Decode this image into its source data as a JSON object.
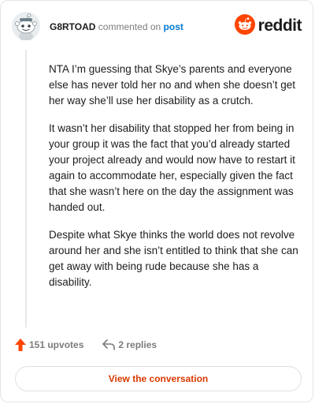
{
  "header": {
    "username": "G8RTOAD",
    "commented_text": "commented on",
    "post_link": "post",
    "brand_name": "reddit"
  },
  "comment": {
    "paragraphs": [
      "NTA I’m guessing that Skye’s parents and everyone else has never told her no and when she doesn’t get her way she’ll use her disability as a crutch.",
      "It wasn’t her disability that stopped her from being in your group it was the fact that you’d already started your project already and would now have to restart it again to accommodate her, especially given the fact that she wasn’t here on the day the assignment was handed out.",
      "Despite what Skye thinks the world does not revolve around her and she isn’t entitled to think that she can get away with being rude because she has a disability."
    ]
  },
  "actions": {
    "upvotes": "151 upvotes",
    "replies": "2 replies",
    "view_conversation": "View the conversation"
  },
  "colors": {
    "brand": "#ff4500",
    "link": "#0079d3",
    "button_text": "#d93a00",
    "muted": "#7c7c7c"
  },
  "icons": {
    "avatar": "snoo-avatar",
    "logo": "reddit-logo-icon",
    "upvote": "upvote-arrow-icon",
    "reply": "reply-arrow-icon"
  }
}
